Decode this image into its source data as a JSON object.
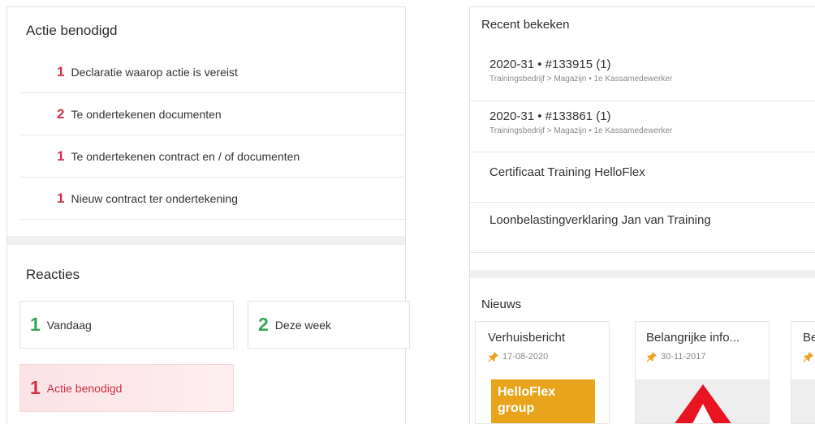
{
  "action_needed": {
    "title": "Actie benodigd",
    "items": [
      {
        "count": "1",
        "label": "Declaratie waarop actie is vereist"
      },
      {
        "count": "2",
        "label": "Te ondertekenen documenten"
      },
      {
        "count": "1",
        "label": "Te ondertekenen contract en / of documenten"
      },
      {
        "count": "1",
        "label": "Nieuw contract ter ondertekening"
      }
    ]
  },
  "reactions": {
    "title": "Reacties",
    "today": {
      "count": "1",
      "label": "Vandaag"
    },
    "this_week": {
      "count": "2",
      "label": "Deze week"
    },
    "action": {
      "count": "1",
      "label": "Actie benodigd"
    }
  },
  "recent": {
    "title": "Recent bekeken",
    "items": [
      {
        "main": "2020-31 • #133915 (1)",
        "sub": "Trainingsbedrijf > Magazijn • 1e Kassamedewerker"
      },
      {
        "main": "2020-31 • #133861 (1)",
        "sub": "Trainingsbedrijf > Magazijn • 1e Kassamedewerker"
      },
      {
        "main": "Certificaat Training HelloFlex",
        "sub": ""
      },
      {
        "main": "Loonbelastingverklaring Jan van Training",
        "sub": ""
      }
    ]
  },
  "news": {
    "title": "Nieuws",
    "items": [
      {
        "title": "Verhuisbericht",
        "date": "17-08-2020",
        "image_text": "HelloFlex group"
      },
      {
        "title": "Belangrijke info...",
        "date": "30-11-2017",
        "image_text": ""
      },
      {
        "title": "Be",
        "date": "",
        "image_text": ""
      }
    ]
  },
  "colors": {
    "alert_red": "#d0304a",
    "positive_green": "#3aa35a",
    "pin_orange": "#f0a020",
    "news_orange": "#e8a51c"
  },
  "icons": {
    "pin": "pin-icon"
  }
}
